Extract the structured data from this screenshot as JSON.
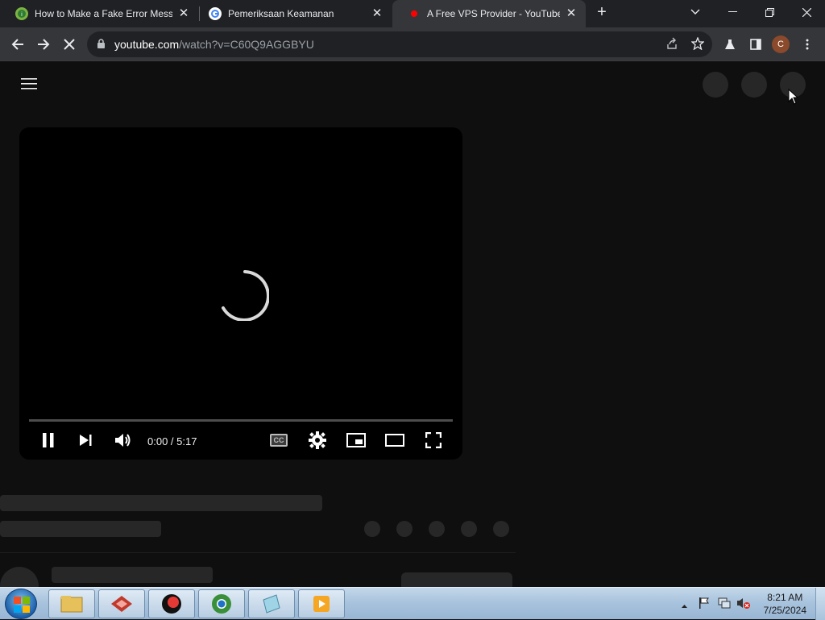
{
  "browser": {
    "tabs": [
      {
        "title": "How to Make a Fake Error Messa",
        "active": false
      },
      {
        "title": "Pemeriksaan Keamanan",
        "active": false
      },
      {
        "title": "A Free VPS Provider - YouTube",
        "active": true
      }
    ],
    "url_domain": "youtube.com",
    "url_path": "/watch?v=C60Q9AGGBYU",
    "profile_initial": "C"
  },
  "player": {
    "time": "0:00 / 5:17",
    "cc_label": "CC"
  },
  "taskbar": {
    "time": "8:21 AM",
    "date": "7/25/2024"
  },
  "colors": {
    "background": "#0f0f0f",
    "skeleton": "#272727",
    "tab_active": "#35363a",
    "tab_strip": "#202124"
  }
}
